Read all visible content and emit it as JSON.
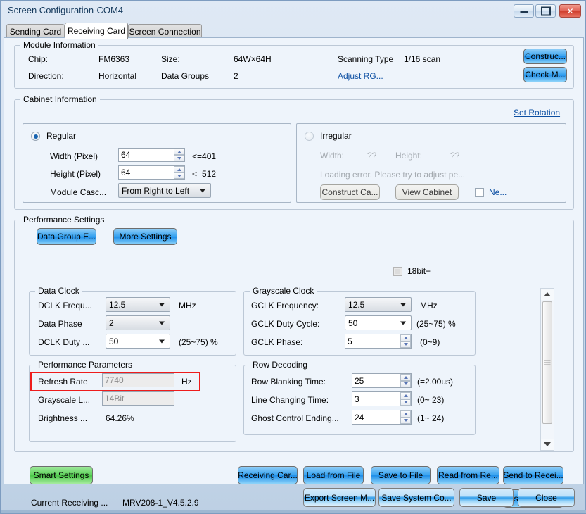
{
  "window": {
    "title": "Screen Configuration-COM4",
    "minimize_label": "minimize",
    "maximize_label": "maximize",
    "close_label": "✕"
  },
  "tabs": [
    {
      "label": "Sending Card",
      "active": false
    },
    {
      "label": "Receiving Card",
      "active": true
    },
    {
      "label": "Screen Connection",
      "active": false
    }
  ],
  "module_information": {
    "legend": "Module Information",
    "chip_label": "Chip:",
    "chip_value": "FM6363",
    "direction_label": "Direction:",
    "direction_value": "Horizontal",
    "size_label": "Size:",
    "size_value": "64W×64H",
    "data_groups_label": "Data Groups",
    "data_groups_value": "2",
    "scanning_type_label": "Scanning Type",
    "scanning_type_value": "1/16 scan",
    "adjust_rg_link": "Adjust RG...",
    "construct_button": "Construc...",
    "check_button": "Check M..."
  },
  "cabinet_information": {
    "legend": "Cabinet Information",
    "set_rotation_link": "Set Rotation",
    "regular": {
      "radio_label": "Regular",
      "selected": true,
      "width_label": "Width (Pixel)",
      "width_value": "64",
      "width_limit": "<=401",
      "height_label": "Height (Pixel)",
      "height_value": "64",
      "height_limit": "<=512",
      "cascade_label": "Module Casc...",
      "cascade_value": "From Right to Left"
    },
    "irregular": {
      "radio_label": "Irregular",
      "selected": false,
      "width_label": "Width:",
      "width_value": "??",
      "height_label": "Height:",
      "height_value": "??",
      "error_text": "Loading error. Please try to adjust pe...",
      "construct_button": "Construct Ca...",
      "view_button": "View Cabinet",
      "new_checkbox_label": "Ne..."
    }
  },
  "performance_settings": {
    "legend": "Performance Settings",
    "data_group_button": "Data Group E...",
    "more_settings_button": "More Settings",
    "bit18_checkbox_label": "18bit+",
    "bit18_checked": false,
    "data_clock": {
      "legend": "Data Clock",
      "dclk_freq_label": "DCLK Frequ...",
      "dclk_freq_value": "12.5",
      "dclk_freq_unit": "MHz",
      "data_phase_label": "Data Phase",
      "data_phase_value": "2",
      "dclk_duty_label": "DCLK Duty ...",
      "dclk_duty_value": "50",
      "dclk_duty_range": "(25~75) %"
    },
    "grayscale_clock": {
      "legend": "Grayscale Clock",
      "gclk_freq_label": "GCLK Frequency:",
      "gclk_freq_value": "12.5",
      "gclk_freq_unit": "MHz",
      "gclk_duty_label": "GCLK Duty Cycle:",
      "gclk_duty_value": "50",
      "gclk_duty_range": "(25~75) %",
      "gclk_phase_label": "GCLK Phase:",
      "gclk_phase_value": "5",
      "gclk_phase_range": "(0~9)"
    },
    "performance_parameters": {
      "legend": "Performance Parameters",
      "refresh_rate_label": "Refresh Rate",
      "refresh_rate_value": "7740",
      "refresh_rate_unit": "Hz",
      "grayscale_label": "Grayscale L...",
      "grayscale_value": "14Bit",
      "brightness_label": "Brightness ...",
      "brightness_value": "64.26%",
      "highlight_color": "#ee1c1c"
    },
    "row_decoding": {
      "legend": "Row Decoding",
      "row_blanking_label": "Row Blanking Time:",
      "row_blanking_value": "25",
      "row_blanking_range": "(=2.00us)",
      "line_changing_label": "Line Changing Time:",
      "line_changing_value": "3",
      "line_changing_range": "(0~ 23)",
      "ghost_control_label": "Ghost Control Ending...",
      "ghost_control_value": "24",
      "ghost_control_range": "(1~ 24)"
    }
  },
  "actions": {
    "smart_settings": "Smart Settings",
    "current_receiving_label": "Current Receiving ...",
    "current_receiving_value": "MRV208-1_V4.5.2.9",
    "receiving_card": "Receiving Car...",
    "load_from_file": "Load from File",
    "save_to_file": "Save to File",
    "read_from_receiving": "Read from Re...",
    "send_to_receiving": "Send to Recei...",
    "restore_factory": "Restore Facto..."
  },
  "footer": {
    "export_screen": "Export Screen M...",
    "save_system": "Save System Co...",
    "save": "Save",
    "close": "Close"
  },
  "colors": {
    "accent_blue": "#1d8de8",
    "link_blue": "#0b4ea2",
    "panel_bg": "#eef4fb",
    "highlight_red": "#ee1c1c"
  }
}
